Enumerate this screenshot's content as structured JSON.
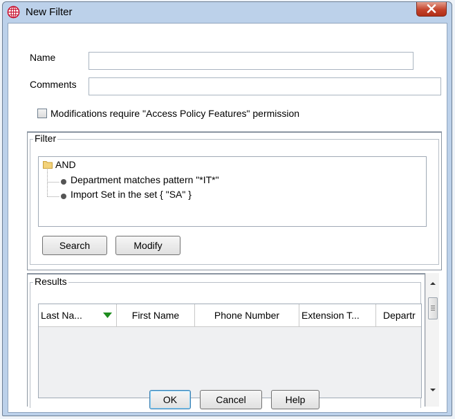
{
  "window": {
    "title": "New Filter",
    "close_icon": "close-icon",
    "app_icon": "globe-icon"
  },
  "form": {
    "name_label": "Name",
    "name_value": "",
    "comments_label": "Comments",
    "comments_value": "",
    "permission_checkbox_label": "Modifications require \"Access Policy Features\" permission",
    "permission_checked": false
  },
  "filter": {
    "legend": "Filter",
    "root": "AND",
    "conditions": [
      "Department matches pattern \"*IT*\"",
      "Import Set in the set { \"SA\" }"
    ],
    "search_label": "Search",
    "modify_label": "Modify"
  },
  "results": {
    "legend": "Results",
    "columns": [
      "Last Na...",
      "First Name",
      "Phone Number",
      "Extension T...",
      "Departr"
    ],
    "sort_column": "Last Na...",
    "sort_direction": "descending",
    "sort_indicator_color": "#1e8c1e",
    "rows": []
  },
  "footer": {
    "ok_label": "OK",
    "cancel_label": "Cancel",
    "help_label": "Help"
  }
}
